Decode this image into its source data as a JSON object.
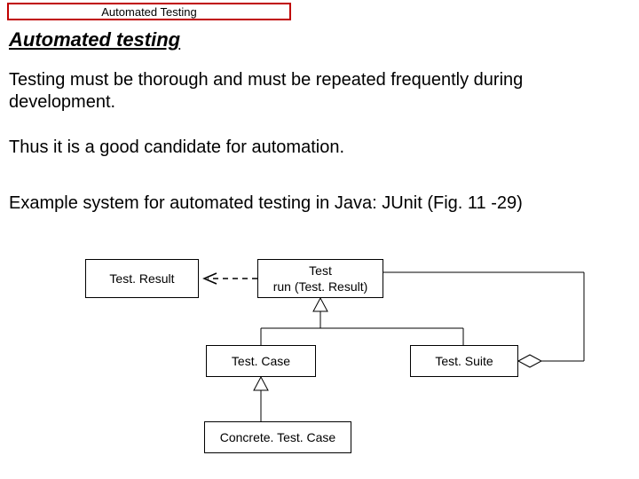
{
  "header_tab": "Automated Testing",
  "title": "Automated testing",
  "para1": "Testing must be thorough and must be repeated frequently during development.",
  "para2": "Thus it is a good candidate for automation.",
  "para3": "Example system for automated testing in Java: JUnit (Fig. 11 -29)",
  "diagram": {
    "test_result": "Test. Result",
    "test": {
      "line1": "Test",
      "line2": "run (Test. Result)"
    },
    "test_case": "Test. Case",
    "test_suite": "Test. Suite",
    "concrete_test_case": "Concrete. Test. Case"
  }
}
